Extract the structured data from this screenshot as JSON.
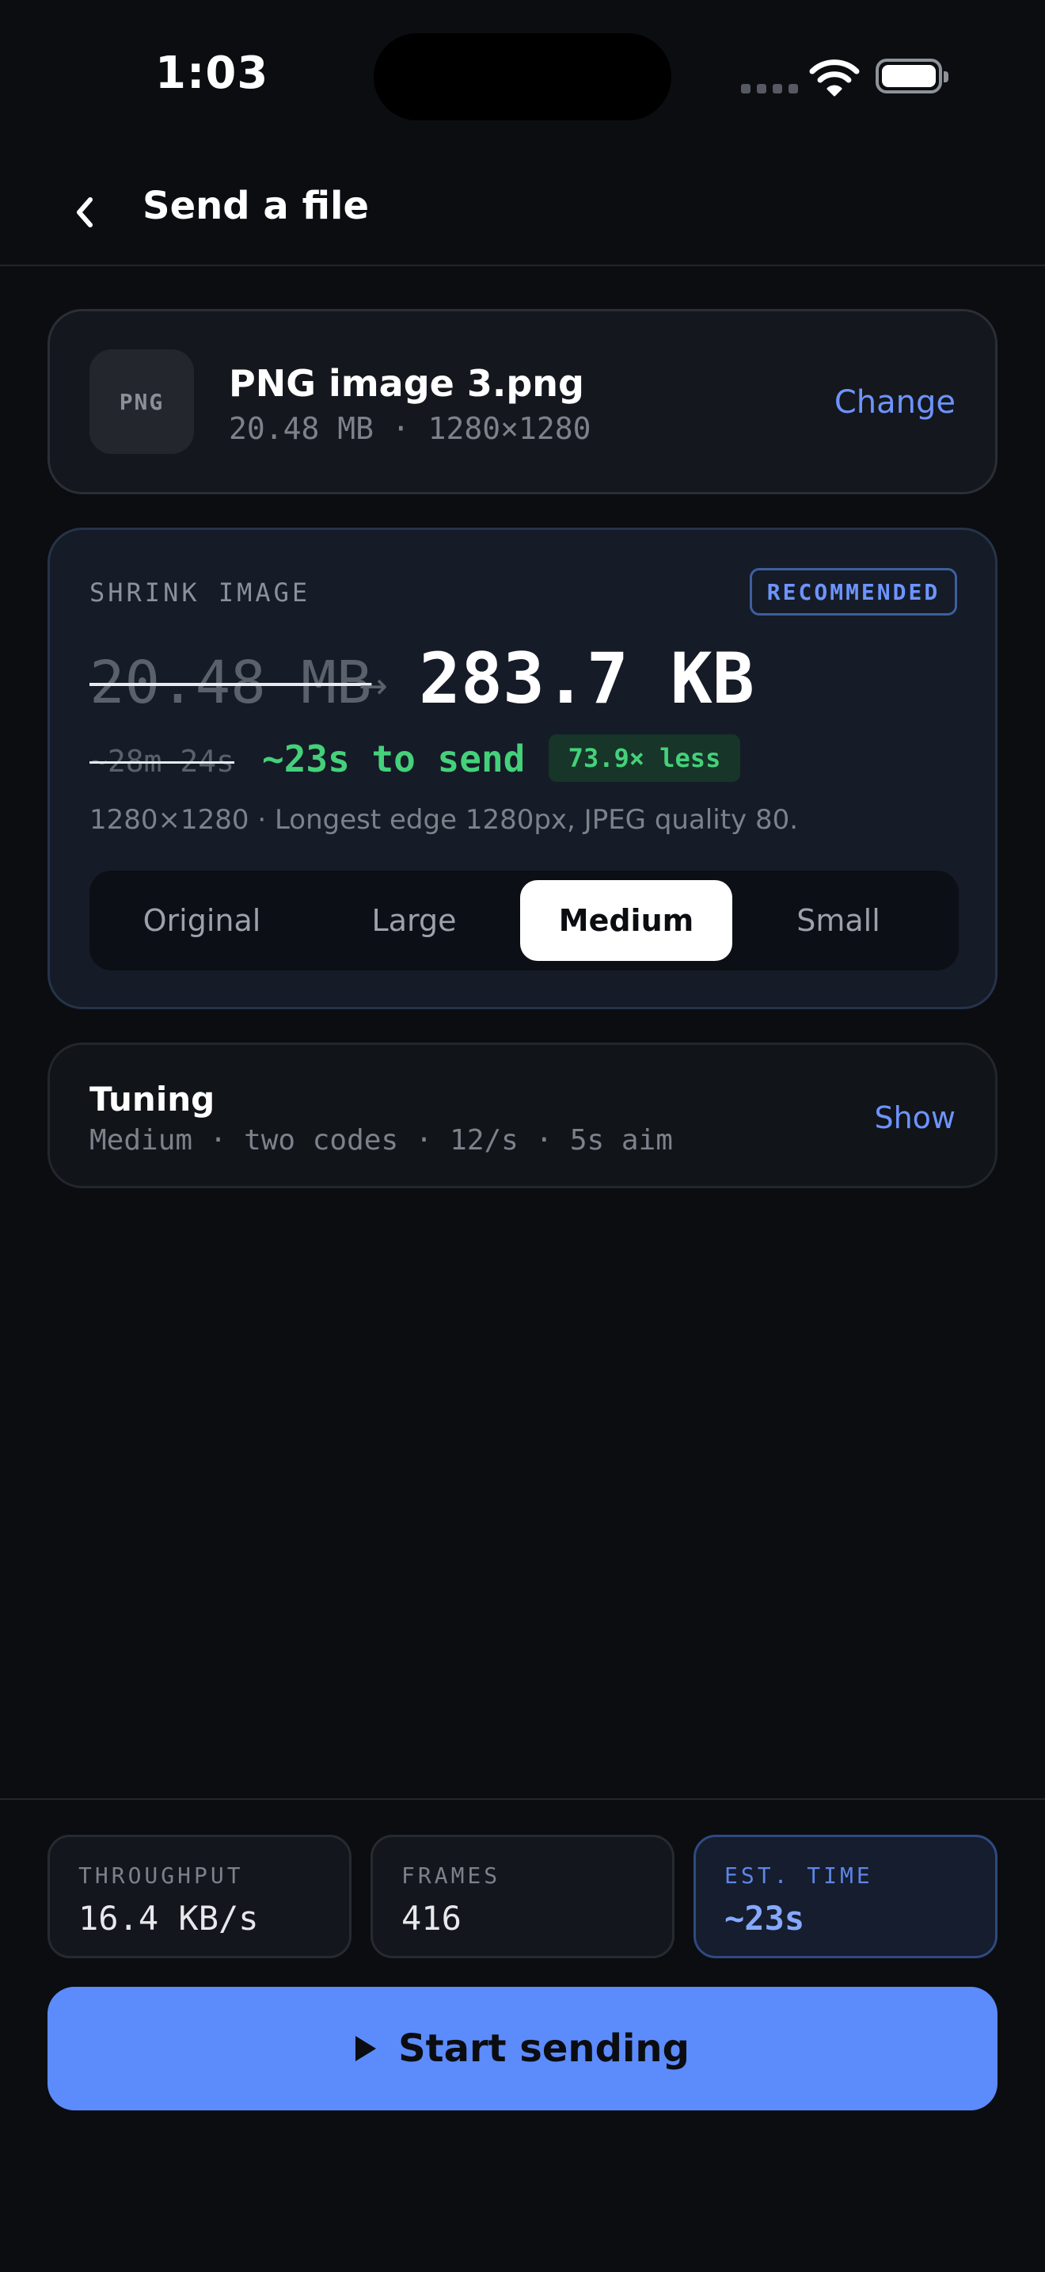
{
  "status_bar": {
    "time": "1:03"
  },
  "header": {
    "title": "Send a file"
  },
  "file": {
    "type_label": "PNG",
    "name": "PNG image 3.png",
    "meta": "20.48 MB · 1280×1280",
    "change_label": "Change"
  },
  "shrink": {
    "heading": "SHRINK IMAGE",
    "badge": "RECOMMENDED",
    "old_size": "20.48 MB",
    "new_size": "283.7 KB",
    "old_time": "~28m 24s",
    "new_time": "~23s to send",
    "reduction": "73.9× less",
    "description": "1280×1280 · Longest edge 1280px, JPEG quality 80.",
    "options": [
      "Original",
      "Large",
      "Medium",
      "Small"
    ],
    "selected": "Medium"
  },
  "tuning": {
    "title": "Tuning",
    "meta": "Medium · two codes · 12/s · 5s aim",
    "show_label": "Show"
  },
  "stats": [
    {
      "label": "THROUGHPUT",
      "value": "16.4 KB/s"
    },
    {
      "label": "FRAMES",
      "value": "416"
    },
    {
      "label": "EST. TIME",
      "value": "~23s"
    }
  ],
  "action": {
    "start_label": "Start sending"
  },
  "colors": {
    "accent": "#5c8bfc",
    "success": "#44d17a",
    "background": "#0b0d11"
  },
  "icons": {
    "back": "chevron-left-icon",
    "arrow": "arrow-right-icon",
    "play": "play-icon",
    "wifi": "wifi-icon",
    "battery": "battery-icon"
  }
}
